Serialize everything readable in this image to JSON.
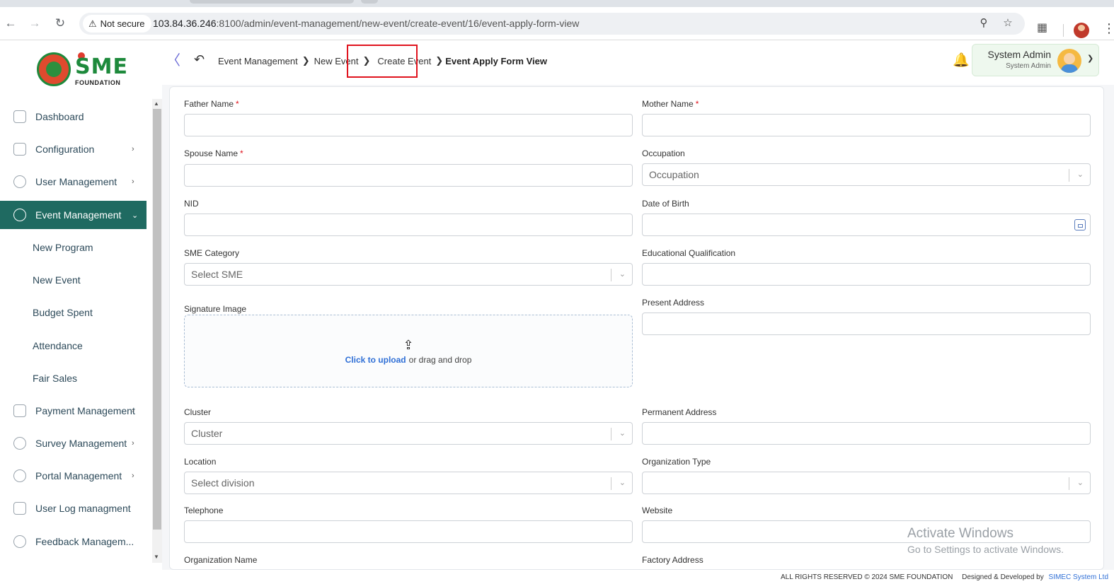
{
  "browser": {
    "security_label": "Not secure",
    "url_host": "103.84.36.246",
    "url_rest": ":8100/admin/event-management/new-event/create-event/16/event-apply-form-view"
  },
  "logo": {
    "text": "SME",
    "subtext": "FOUNDATION"
  },
  "breadcrumb": {
    "items": [
      "Event Management",
      "New Event",
      "Create Event"
    ],
    "current": "Event Apply Form View"
  },
  "user": {
    "name": "System Admin",
    "role": "System Admin"
  },
  "sidebar": {
    "items": [
      {
        "label": "Dashboard"
      },
      {
        "label": "Configuration"
      },
      {
        "label": "User Management"
      },
      {
        "label": "Event Management"
      },
      {
        "label": "Payment Management"
      },
      {
        "label": "Survey Management"
      },
      {
        "label": "Portal Management"
      },
      {
        "label": "User Log managment"
      },
      {
        "label": "Feedback Managem..."
      }
    ],
    "sub_items": [
      {
        "label": "New Program"
      },
      {
        "label": "New Event"
      },
      {
        "label": "Budget Spent"
      },
      {
        "label": "Attendance"
      },
      {
        "label": "Fair Sales"
      }
    ]
  },
  "form": {
    "father_name": {
      "label": "Father Name",
      "required": "*"
    },
    "mother_name": {
      "label": "Mother Name",
      "required": "*"
    },
    "spouse_name": {
      "label": "Spouse Name",
      "required": "*"
    },
    "occupation": {
      "label": "Occupation",
      "placeholder": "Occupation"
    },
    "nid": {
      "label": "NID"
    },
    "dob": {
      "label": "Date of Birth"
    },
    "sme_category": {
      "label": "SME Category",
      "placeholder": "Select SME"
    },
    "education": {
      "label": "Educational Qualification"
    },
    "signature": {
      "label": "Signature Image",
      "upload_link": "Click to upload",
      "upload_text": "or drag and drop"
    },
    "present_address": {
      "label": "Present Address"
    },
    "cluster": {
      "label": "Cluster",
      "placeholder": "Cluster"
    },
    "permanent_address": {
      "label": "Permanent Address"
    },
    "location": {
      "label": "Location",
      "placeholder": "Select division"
    },
    "org_type": {
      "label": "Organization Type",
      "placeholder": ""
    },
    "telephone": {
      "label": "Telephone"
    },
    "website": {
      "label": "Website"
    },
    "org_name": {
      "label": "Organization Name"
    },
    "factory_address": {
      "label": "Factory Address"
    }
  },
  "watermark": {
    "line1": "Activate Windows",
    "line2": "Go to Settings to activate Windows."
  },
  "footer": {
    "rights": "ALL RIGHTS RESERVED © 2024 SME FOUNDATION",
    "designed": "Designed & Developed by",
    "developer": "SIMEC System Ltd"
  },
  "colors": {
    "sidebar_active": "#1f6a61",
    "required": "#e0141e",
    "link": "#2f6fd6",
    "highlight_box": "#e0141e"
  }
}
